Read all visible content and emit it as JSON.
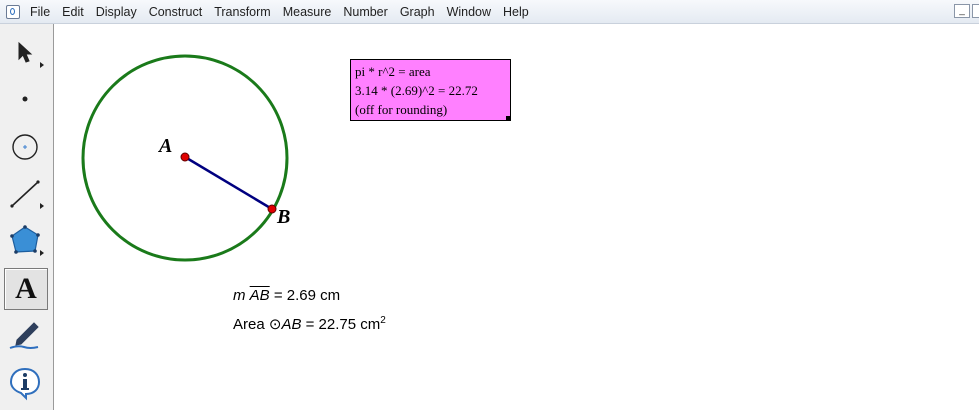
{
  "menubar": {
    "items": [
      "File",
      "Edit",
      "Display",
      "Construct",
      "Transform",
      "Measure",
      "Number",
      "Graph",
      "Window",
      "Help"
    ]
  },
  "toolbox": {
    "tools": [
      {
        "icon": "arrow-select-icon",
        "selected": false
      },
      {
        "icon": "point-tool-icon",
        "selected": false
      },
      {
        "icon": "compass-tool-icon",
        "selected": false
      },
      {
        "icon": "line-tool-icon",
        "selected": false
      },
      {
        "icon": "polygon-tool-icon",
        "selected": false
      },
      {
        "icon": "text-tool-icon",
        "selected": true
      },
      {
        "icon": "marker-tool-icon",
        "selected": false
      },
      {
        "icon": "information-tool-icon",
        "selected": false
      }
    ],
    "text_tool_glyph": "A"
  },
  "figure": {
    "point_a": "A",
    "point_b": "B",
    "circle_color": "#1a7a1a",
    "segment_color": "#000080",
    "point_color": "#e00000"
  },
  "caption": {
    "line1": "pi * r^2 = area",
    "line2": "3.14 * (2.69)^2 = 22.72",
    "line3": "(off for rounding)",
    "background": "#ff80ff"
  },
  "measurements": {
    "length_prefix": "m",
    "length_segment": "AB",
    "length_value": "= 2.69 cm",
    "area_prefix": "Area",
    "area_symbol": "⊙",
    "area_circle": "AB",
    "area_value": "= 22.75 cm",
    "area_exponent": "2"
  }
}
